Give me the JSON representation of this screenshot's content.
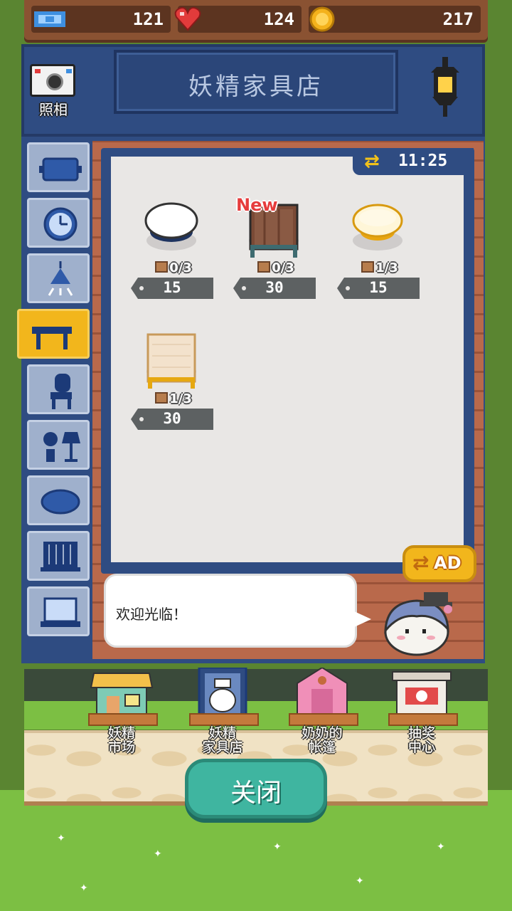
{
  "resources": {
    "tickets": "121",
    "hearts": "124",
    "coins": "217"
  },
  "header": {
    "shop_title": "妖精家具店",
    "camera_label": "照相"
  },
  "refresh_timer": "11:25",
  "side_tabs": [
    {
      "name": "tab-tray",
      "icon": "tray-icon",
      "active": false
    },
    {
      "name": "tab-clock",
      "icon": "clock-icon",
      "active": false
    },
    {
      "name": "tab-ceiling-lamp",
      "icon": "ceiling-lamp-icon",
      "active": false
    },
    {
      "name": "tab-table",
      "icon": "table-icon",
      "active": true
    },
    {
      "name": "tab-chair",
      "icon": "chair-icon",
      "active": false
    },
    {
      "name": "tab-plants",
      "icon": "plant-lamp-icon",
      "active": false
    },
    {
      "name": "tab-rug",
      "icon": "rug-icon",
      "active": false
    },
    {
      "name": "tab-window",
      "icon": "window-icon",
      "active": false
    },
    {
      "name": "tab-counter",
      "icon": "counter-icon",
      "active": false
    }
  ],
  "shop_items": [
    {
      "stock": "0/3",
      "price": "15",
      "is_new": false,
      "kind": "white-round-table"
    },
    {
      "stock": "0/3",
      "price": "30",
      "is_new": true,
      "new_label": "New",
      "kind": "wooden-table"
    },
    {
      "stock": "1/3",
      "price": "15",
      "is_new": false,
      "kind": "yellow-round-table"
    },
    {
      "stock": "1/3",
      "price": "30",
      "is_new": false,
      "kind": "pine-table"
    }
  ],
  "ad_button": "AD",
  "speech": "欢迎光临！",
  "bottom_nav": [
    {
      "label": "妖精\n市场"
    },
    {
      "label": "妖精\n家具店"
    },
    {
      "label": "奶奶的\n帐篷"
    },
    {
      "label": "抽奖\n中心"
    }
  ],
  "close_button": "关闭",
  "colors": {
    "panel_blue": "#2f4c82",
    "active_tab": "#f2b61c",
    "close_green": "#3fb5a0",
    "new_red": "#e63c3c"
  }
}
